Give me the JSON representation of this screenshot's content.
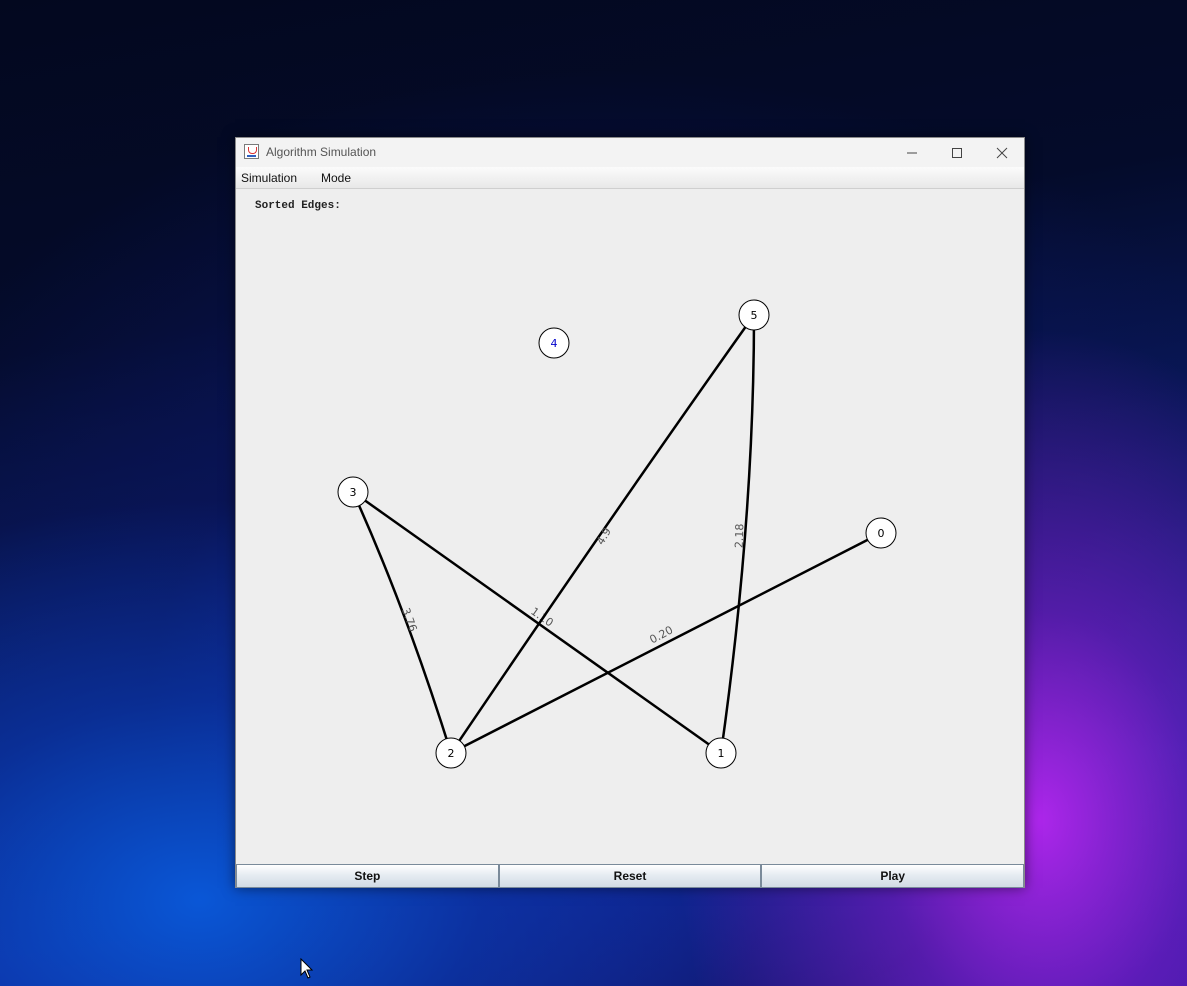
{
  "window": {
    "title": "Algorithm Simulation"
  },
  "menu": {
    "items": [
      "Simulation",
      "Mode"
    ]
  },
  "canvas": {
    "sorted_edges_label": "Sorted Edges:"
  },
  "graph": {
    "nodes": [
      {
        "id": "0",
        "label": "0",
        "color": "#000000"
      },
      {
        "id": "1",
        "label": "1",
        "color": "#000000"
      },
      {
        "id": "2",
        "label": "2",
        "color": "#000000"
      },
      {
        "id": "3",
        "label": "3",
        "color": "#000000"
      },
      {
        "id": "4",
        "label": "4",
        "color": "#0000cc"
      },
      {
        "id": "5",
        "label": "5",
        "color": "#000000"
      }
    ],
    "edges": [
      {
        "from": "3",
        "to": "2",
        "weight": "3.76"
      },
      {
        "from": "3",
        "to": "1",
        "weight": "1.10"
      },
      {
        "from": "2",
        "to": "5",
        "weight": "4.9"
      },
      {
        "from": "2",
        "to": "0",
        "weight": "0.20"
      },
      {
        "from": "1",
        "to": "5",
        "weight": "2.18"
      }
    ]
  },
  "buttons": {
    "step": "Step",
    "reset": "Reset",
    "play": "Play"
  }
}
